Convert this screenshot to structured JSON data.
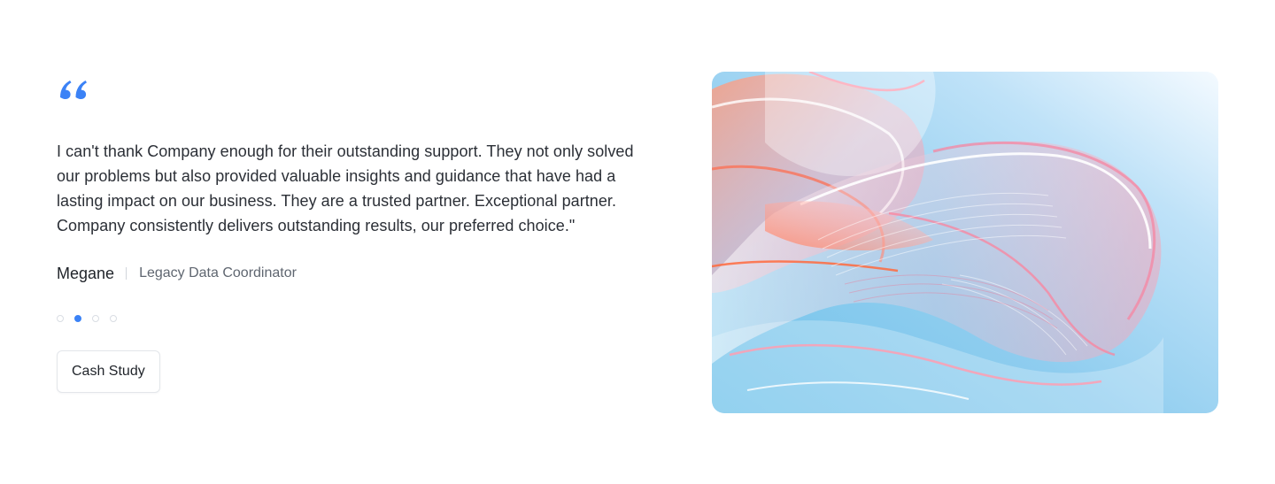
{
  "testimonial": {
    "quote_icon": "quote-open-icon",
    "accent_color": "#3b82f6",
    "text": "I can't thank Company enough for their outstanding support. They not only solved our problems but also provided valuable insights and guidance that have had a lasting impact on our business. They are a trusted partner. Exceptional partner. Company consistently delivers outstanding results, our preferred choice.\"",
    "author": {
      "name": "Megane",
      "role": "Legacy Data Coordinator"
    },
    "pagination": {
      "total": 4,
      "active_index": 1
    },
    "cta_label": "Cash Study"
  },
  "media": {
    "image_description_icon": "abstract-glass-ribbon-image"
  }
}
